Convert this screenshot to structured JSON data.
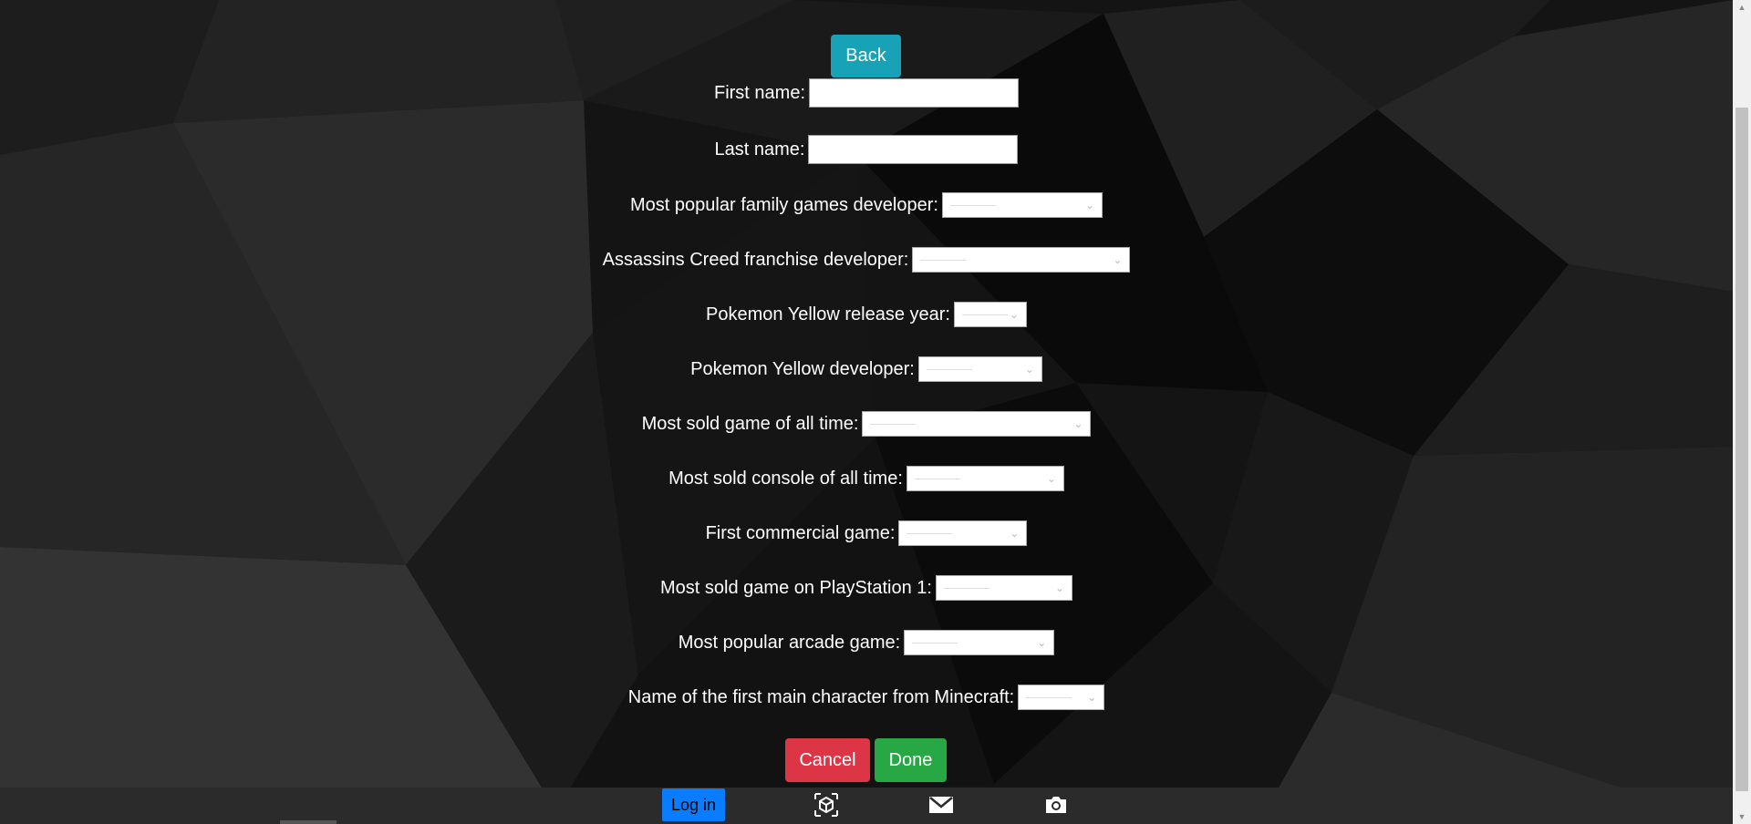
{
  "back_button": "Back",
  "form": {
    "first_name": {
      "label": "First name:",
      "value": ""
    },
    "last_name": {
      "label": "Last name:",
      "value": ""
    },
    "questions": [
      {
        "label": "Most popular family games developer:",
        "selected": ""
      },
      {
        "label": "Assassins Creed franchise developer:",
        "selected": ""
      },
      {
        "label": "Pokemon Yellow release year:",
        "selected": ""
      },
      {
        "label": "Pokemon Yellow developer:",
        "selected": ""
      },
      {
        "label": "Most sold game of all time:",
        "selected": ""
      },
      {
        "label": "Most sold console of all time:",
        "selected": ""
      },
      {
        "label": "First commercial game:",
        "selected": ""
      },
      {
        "label": "Most sold game on PlayStation 1:",
        "selected": ""
      },
      {
        "label": "Most popular arcade game:",
        "selected": ""
      },
      {
        "label": "Name of the first main character from Minecraft:",
        "selected": ""
      }
    ]
  },
  "actions": {
    "cancel": "Cancel",
    "done": "Done"
  },
  "bottom_bar": {
    "login": "Log in",
    "icons": [
      "cube-icon",
      "mail-icon",
      "camera-icon"
    ]
  },
  "colors": {
    "back": "#17a2b8",
    "cancel": "#dc3545",
    "done": "#28a745",
    "login": "#0a7cff"
  }
}
